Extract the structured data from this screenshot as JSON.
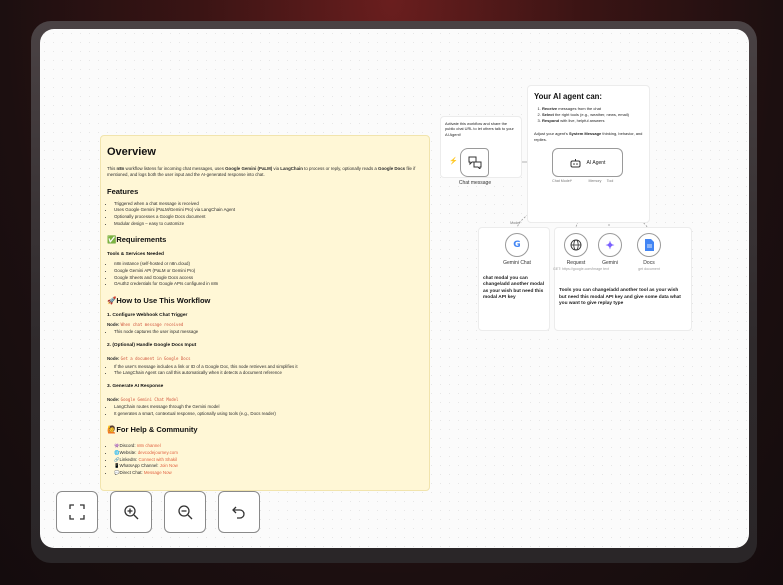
{
  "overview": {
    "title": "Overview",
    "intro_a": "This ",
    "intro_b": "n8n",
    "intro_c": " workflow listens for incoming chat messages, uses ",
    "intro_d": "Google Gemini (PaLM)",
    "intro_e": " via ",
    "intro_f": "LangChain",
    "intro_g": " to process or reply, optionally reads a ",
    "intro_h": "Google Docs",
    "intro_i": " file if mentioned, and logs both the user input and the AI-generated response into chat.",
    "features_title": "Features",
    "features": [
      "Triggered when a chat message is received",
      "Uses Google Gemini (PaLM/Gemini Pro) via LangChain Agent",
      "Optionally processes a Google Docs document",
      "Modular design – easy to customize"
    ],
    "requirements_title": "✅Requirements",
    "tools_needed_title": "Tools & Services Needed",
    "tools_needed": [
      "n8n instance (self-hosted or n8n.cloud)",
      "Google Gemini API (PaLM or Gemini Pro)",
      "Google Sheets and Google Docs access",
      "OAuth2 credentials for Google APIs configured in n8n"
    ],
    "howto_title": "🚀How to Use This Workflow",
    "step1_title": "1. Configure Webhook Chat Trigger",
    "step1_node_label": "Node: ",
    "step1_node": "When chat message received",
    "step1_items": [
      "This node captures the user input message"
    ],
    "step2_title": "2. (Optional) Handle Google Docs Input",
    "step2_node_label": "Node: ",
    "step2_node": "Get a document in Google Docs",
    "step2_items": [
      "If the user's message includes a link or ID of a Google Doc, this node retrieves and simplifies it",
      "The LangChain Agent can call this automatically when it detects a document reference"
    ],
    "step3_title": "3. Generate AI Response",
    "step3_node_label": "Node: ",
    "step3_node": "Google Gemini Chat Model",
    "step3_items": [
      "LangChain routes message through the Gemini model",
      "It generates a smart, contextual response, optionally using tools (e.g., Docs reader)"
    ],
    "help_title": "🙋For Help & Community",
    "help_items": [
      {
        "label": "👾Discord: ",
        "value": "n8n channel"
      },
      {
        "label": "🌐Website: ",
        "value": "devcodejourney.com"
      },
      {
        "label": "🔗LinkedIn: ",
        "value": "Connect with Shakil"
      },
      {
        "label": "📱WhatsApp Channel: ",
        "value": "Join Now"
      },
      {
        "label": "💬Direct Chat: ",
        "value": "Message Now"
      }
    ]
  },
  "agent_note": {
    "title": "Your AI agent can:",
    "items": [
      {
        "bold": "Receive",
        "rest": " messages from the chat"
      },
      {
        "bold": "Select",
        "rest": " the right tools (e.g., weather, news, email)"
      },
      {
        "bold": "Respond",
        "rest": " with live, helpful answers"
      }
    ],
    "footer_a": "Adjust your agent's ",
    "footer_b": "System Message",
    "footer_c": " thinking, behavior, and replies."
  },
  "trigger_note": {
    "text": "Activate this workflow and share the public chat URL to let others talk to your AI Agent!"
  },
  "nodes": {
    "chat_message": "Chat message",
    "ai_agent": "AI Agent",
    "port_chat_model": "Chat Model*",
    "port_memory": "Memory",
    "port_tool": "Tool",
    "model_edge": "Model",
    "gemini_chat": "Gemini Chat",
    "request": "Request",
    "request_sub": "GET: https://google.com/image text",
    "gemini": "Gemini",
    "docs": "Docs",
    "docs_sub": "get document"
  },
  "gemini_note": {
    "text": "chat modal you can change/add another modal as your wish but need this modal API key"
  },
  "tools_note": {
    "text": "Tools you can change/add another tool as your wish but need this modal API key and give some data what you want to give replay type"
  },
  "controls": {
    "fit": "fit-view-icon",
    "zoom_in": "zoom-in-icon",
    "zoom_out": "zoom-out-icon",
    "undo": "undo-icon"
  }
}
